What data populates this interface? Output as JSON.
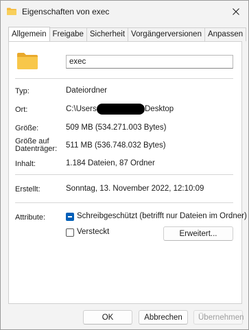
{
  "window": {
    "title": "Eigenschaften von exec"
  },
  "tabs": [
    "Allgemein",
    "Freigabe",
    "Sicherheit",
    "Vorgängerversionen",
    "Anpassen"
  ],
  "general": {
    "name_value": "exec",
    "rows": {
      "type": {
        "label": "Typ:",
        "value": "Dateiordner"
      },
      "location": {
        "label": "Ort:",
        "value_prefix": "C:\\Users",
        "value_suffix": "Desktop"
      },
      "size": {
        "label": "Größe:",
        "value": "509 MB (534.271.003 Bytes)"
      },
      "size_on_disk": {
        "label_line1": "Größe auf",
        "label_line2": "Datenträger:",
        "value": "511 MB (536.748.032 Bytes)"
      },
      "contents": {
        "label": "Inhalt:",
        "value": "1.184 Dateien, 87 Ordner"
      },
      "created": {
        "label": "Erstellt:",
        "value": "Sonntag, 13. November 2022, 12:10:09"
      }
    },
    "attributes": {
      "label": "Attribute:",
      "readonly_label": "Schreibgeschützt (betrifft nur Dateien im Ordner)",
      "hidden_label": "Versteckt",
      "advanced_button": "Erweitert..."
    }
  },
  "footer": {
    "ok": "OK",
    "cancel": "Abbrechen",
    "apply": "Übernehmen"
  },
  "colors": {
    "accent": "#005fb8",
    "folder": "#f8c74a"
  }
}
